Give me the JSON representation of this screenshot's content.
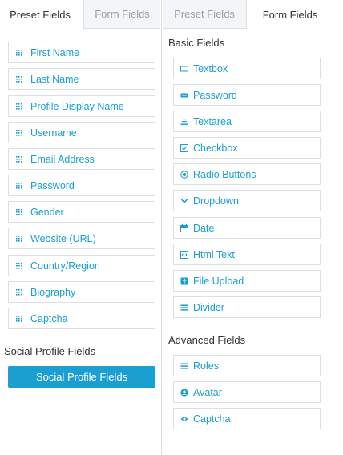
{
  "tabs": {
    "preset_fields_left": "Preset Fields",
    "form_fields_left": "Form Fields",
    "preset_fields_right": "Preset Fields",
    "form_fields_right": "Form Fields"
  },
  "preset_fields": [
    {
      "label": "First Name"
    },
    {
      "label": "Last Name"
    },
    {
      "label": "Profile Display Name"
    },
    {
      "label": "Username"
    },
    {
      "label": "Email Address"
    },
    {
      "label": "Password"
    },
    {
      "label": "Gender"
    },
    {
      "label": "Website (URL)"
    },
    {
      "label": "Country/Region"
    },
    {
      "label": "Biography"
    },
    {
      "label": "Captcha"
    }
  ],
  "social": {
    "title": "Social Profile Fields",
    "button_label": "Social Profile Fields"
  },
  "basic_fields": {
    "title": "Basic Fields",
    "items": [
      {
        "label": "Textbox",
        "icon": "textbox-icon"
      },
      {
        "label": "Password",
        "icon": "password-icon"
      },
      {
        "label": "Textarea",
        "icon": "textarea-icon"
      },
      {
        "label": "Checkbox",
        "icon": "checkbox-icon"
      },
      {
        "label": "Radio Buttons",
        "icon": "radio-icon"
      },
      {
        "label": "Dropdown",
        "icon": "chevron-down-icon"
      },
      {
        "label": "Date",
        "icon": "calendar-icon"
      },
      {
        "label": "Html Text",
        "icon": "html-icon"
      },
      {
        "label": "File Upload",
        "icon": "upload-icon"
      },
      {
        "label": "Divider",
        "icon": "divider-icon"
      }
    ]
  },
  "advanced_fields": {
    "title": "Advanced Fields",
    "items": [
      {
        "label": "Roles",
        "icon": "roles-icon"
      },
      {
        "label": "Avatar",
        "icon": "avatar-icon"
      },
      {
        "label": "Captcha",
        "icon": "eye-icon"
      }
    ]
  },
  "colors": {
    "accent": "#1a9fd0",
    "border": "#dcdfe3",
    "inactive_tab_bg": "#f4f5f6"
  }
}
